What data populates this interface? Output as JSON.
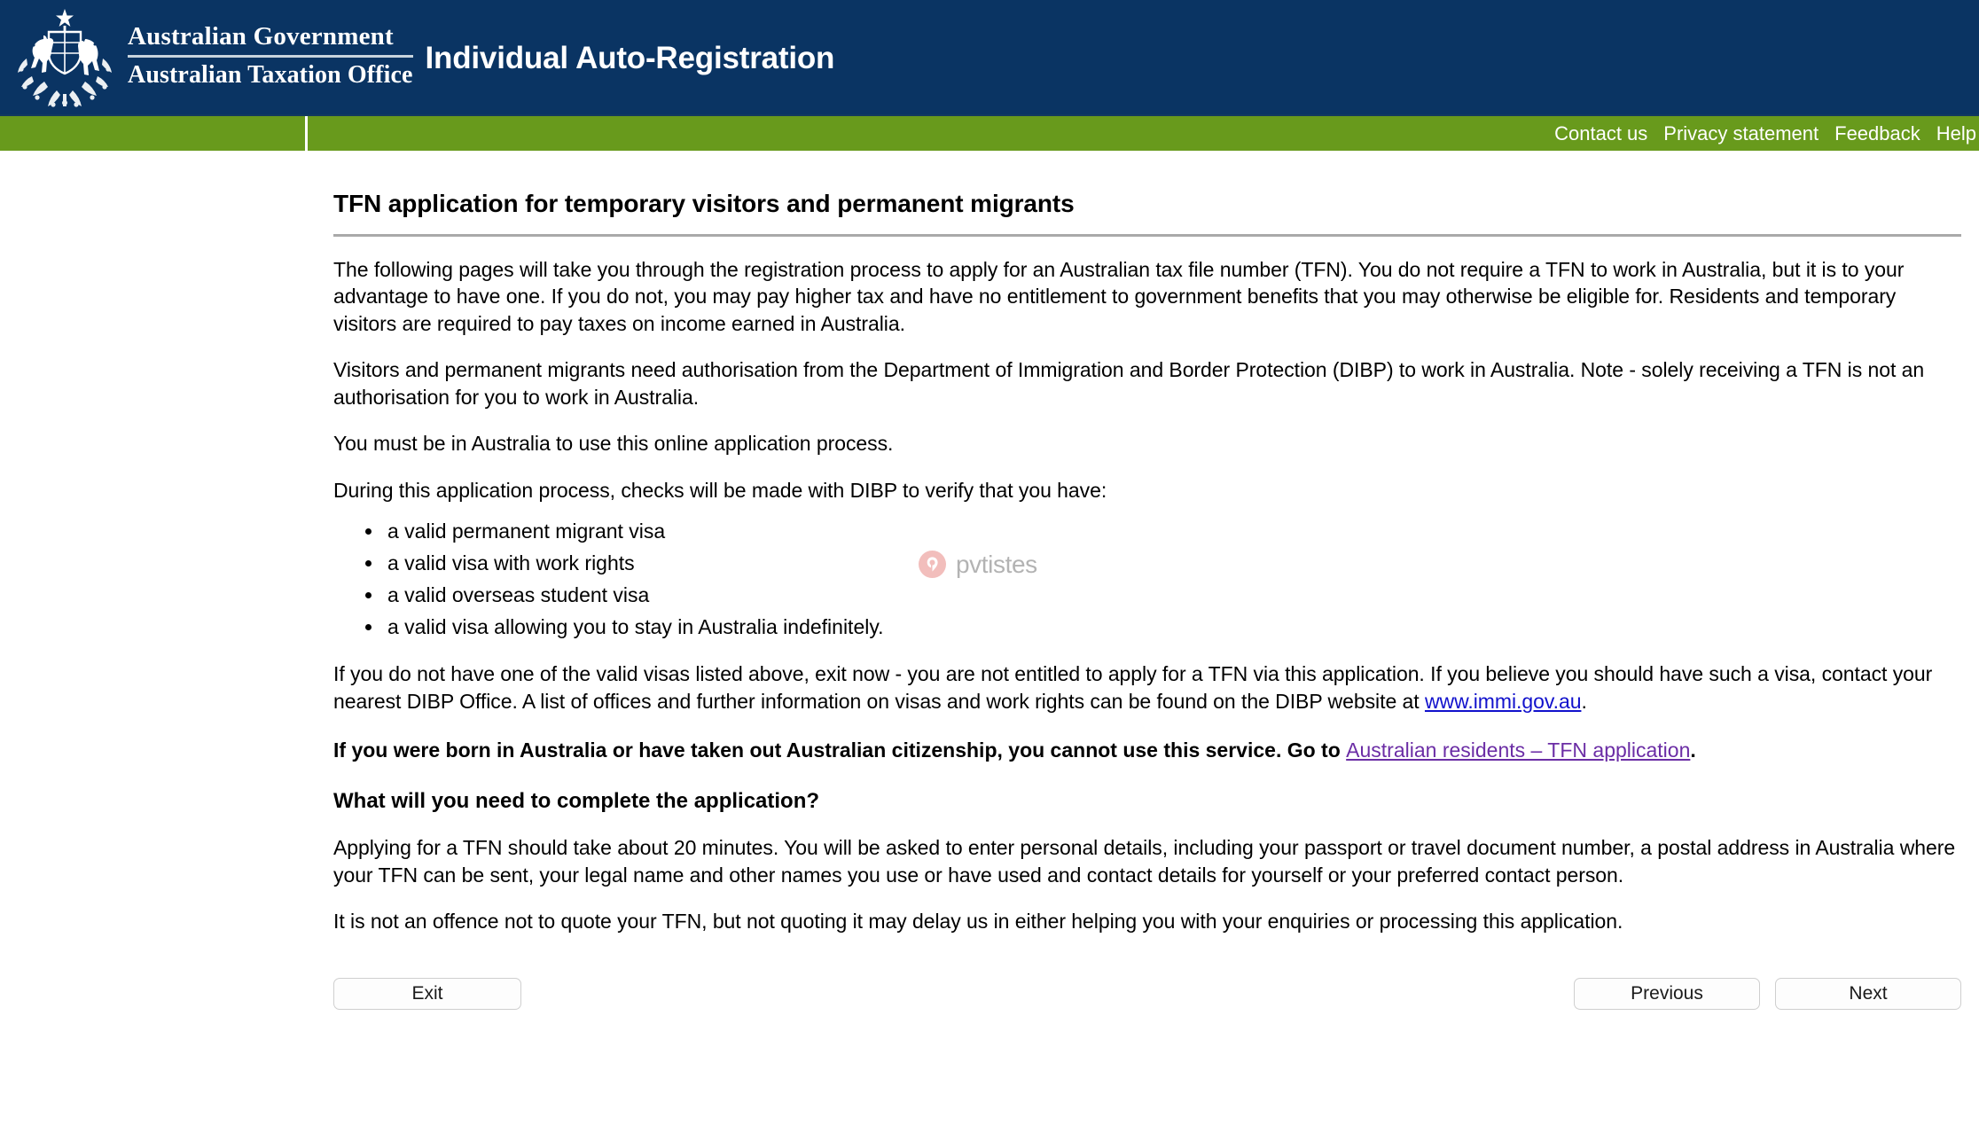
{
  "header": {
    "crest_icon": "australian-coat-of-arms",
    "gov_line1": "Australian Government",
    "gov_line2": "Australian Taxation Office",
    "app_title": "Individual Auto-Registration",
    "background_color": "#0a3463"
  },
  "nav": {
    "background_color": "#689a1c",
    "links": [
      {
        "label": "Contact us"
      },
      {
        "label": "Privacy statement"
      },
      {
        "label": "Feedback"
      },
      {
        "label": "Help"
      }
    ]
  },
  "main": {
    "title": "TFN application for temporary visitors and permanent migrants",
    "paragraph_1": "The following pages will take you through the registration process to apply for an Australian tax file number (TFN). You do not require a TFN to work in Australia, but it is to your advantage to have one. If you do not, you may pay higher tax and have no entitlement to government benefits that you may otherwise be eligible for. Residents and temporary visitors are required to pay taxes on income earned in Australia.",
    "paragraph_2": "Visitors and permanent migrants need authorisation from the Department of Immigration and Border Protection (DIBP) to work in Australia. Note - solely receiving a TFN is not an authorisation for you to work in Australia.",
    "paragraph_3": "You must be in Australia to use this online application process.",
    "paragraph_4": "During this application process, checks will be made with DIBP to verify that you have:",
    "visa_list": [
      "a valid permanent migrant visa",
      "a valid visa with work rights",
      "a valid overseas student visa",
      "a valid visa allowing you to stay in Australia indefinitely."
    ],
    "paragraph_5_before_link": "If you do not have one of the valid visas listed above, exit now - you are not entitled to apply for a TFN via this application. If you believe you should have such a visa, contact your nearest DIBP Office. A list of offices and further information on visas and work rights can be found on the DIBP website at ",
    "paragraph_5_link": "www.immi.gov.au",
    "paragraph_5_after_link": ".",
    "bold_statement_before_link": "If you were born in Australia or have taken out Australian citizenship, you cannot use this service. Go to ",
    "bold_statement_link": "Australian residents – TFN application",
    "bold_statement_after_link": ".",
    "sub_heading": "What will you need to complete the application?",
    "paragraph_6": "Applying for a TFN should take about 20 minutes. You will be asked to enter personal details, including your passport or travel document number, a postal address in Australia where your TFN can be sent, your legal name and other names you use or have used and contact details for yourself or your preferred contact person.",
    "paragraph_7": "It is not an offence not to quote your TFN, but not quoting it may delay us in either helping you with your enquiries or processing this application."
  },
  "watermark": {
    "text": "pvtistes",
    "icon": "pvtistes-logo-icon",
    "badge_color": "#f0b3b1",
    "text_color": "#a6a6a6"
  },
  "buttons": {
    "exit": "Exit",
    "previous": "Previous",
    "next": "Next"
  },
  "link_colors": {
    "unvisited": "#1111cc",
    "visited": "#6b2da5"
  }
}
